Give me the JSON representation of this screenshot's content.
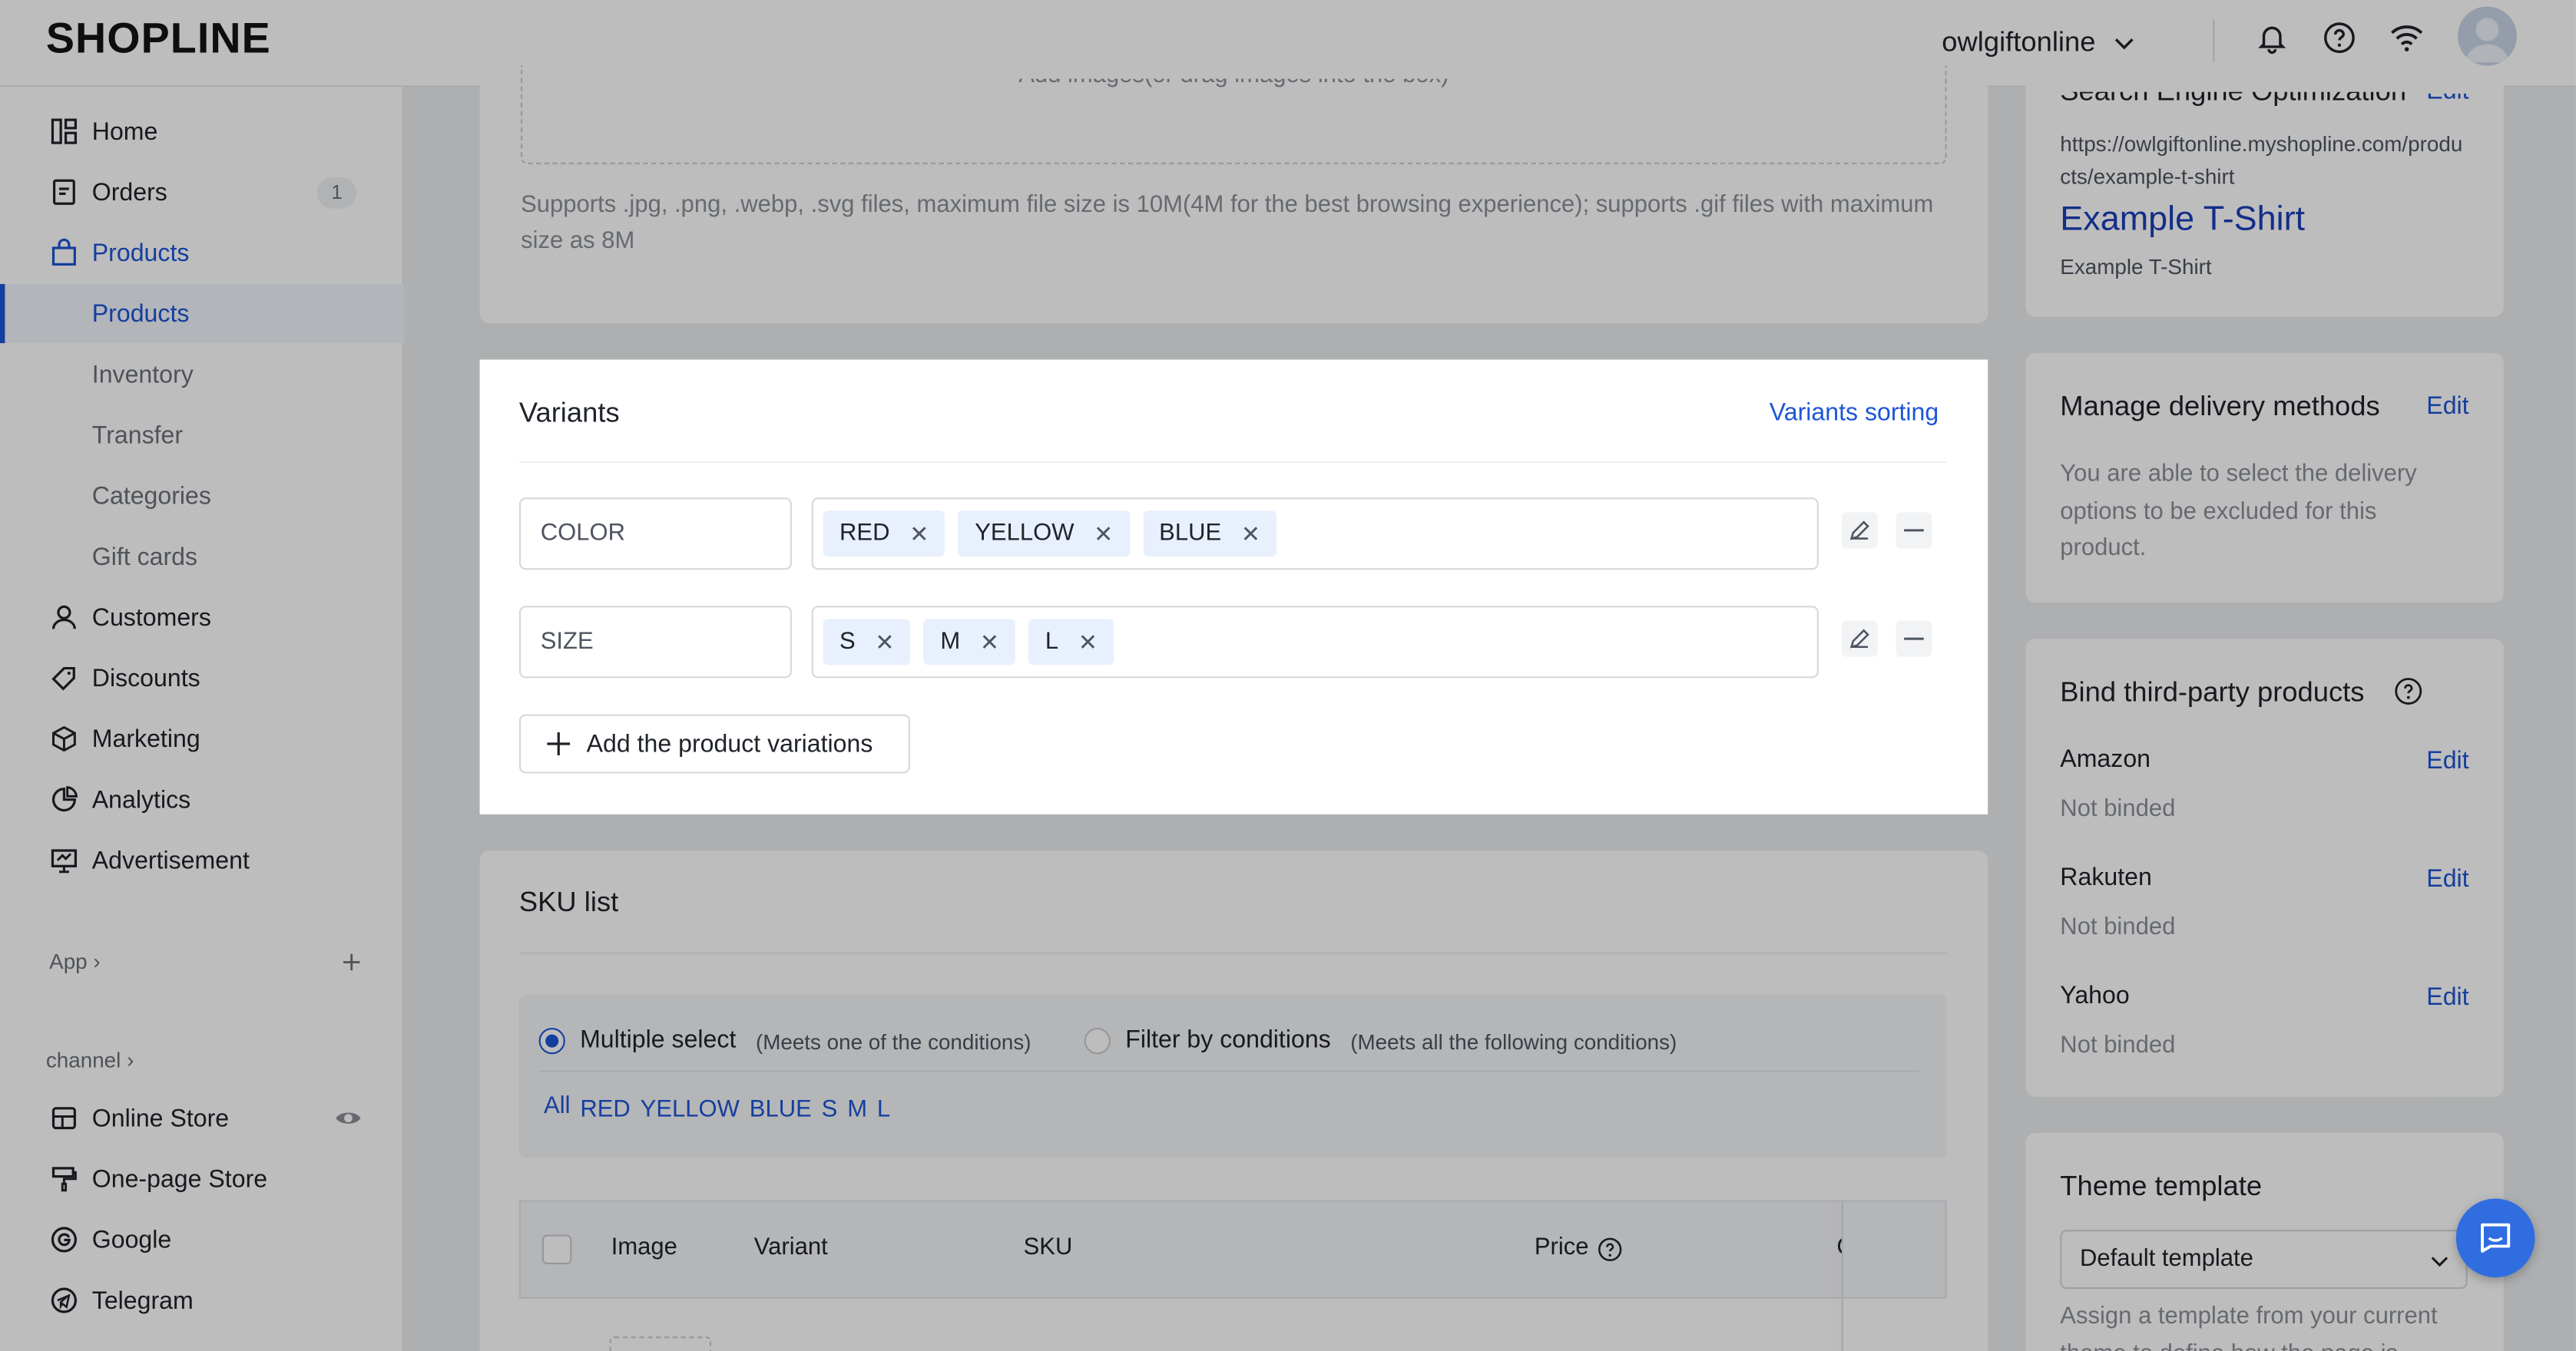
{
  "topbar": {
    "logo": "SHOPLINE",
    "store_name": "owlgiftonline",
    "icons": [
      "bell-icon",
      "help-icon",
      "wifi-icon",
      "avatar"
    ]
  },
  "sidebar": {
    "items": [
      {
        "label": "Home",
        "icon": "home-icon"
      },
      {
        "label": "Orders",
        "icon": "orders-icon",
        "badge": "1"
      },
      {
        "label": "Products",
        "icon": "bag-icon"
      },
      {
        "label": "Products"
      },
      {
        "label": "Inventory"
      },
      {
        "label": "Transfer"
      },
      {
        "label": "Categories"
      },
      {
        "label": "Gift cards"
      },
      {
        "label": "Customers",
        "icon": "person-icon"
      },
      {
        "label": "Discounts",
        "icon": "tag-icon"
      },
      {
        "label": "Marketing",
        "icon": "cube-icon"
      },
      {
        "label": "Analytics",
        "icon": "pie-icon"
      },
      {
        "label": "Advertisement",
        "icon": "monitor-icon"
      }
    ],
    "app_label": "App",
    "channel_label": "channel",
    "channels": [
      {
        "label": "Online Store",
        "icon": "store-icon"
      },
      {
        "label": "One-page Store",
        "icon": "brush-icon"
      },
      {
        "label": "Google",
        "icon": "google-icon"
      },
      {
        "label": "Telegram",
        "icon": "telegram-icon"
      }
    ]
  },
  "media": {
    "upload_text": "Add images(or drag images into the box)",
    "hint": "Supports .jpg, .png, .webp, .svg files, maximum file size is 10M(4M for the best browsing experience); supports .gif files with maximum size as 8M"
  },
  "variants": {
    "title": "Variants",
    "sorting_link": "Variants sorting",
    "options": [
      {
        "name": "COLOR",
        "values": [
          "RED",
          "YELLOW",
          "BLUE"
        ]
      },
      {
        "name": "SIZE",
        "values": [
          "S",
          "M",
          "L"
        ]
      }
    ],
    "add_button": "Add the product variations"
  },
  "sku": {
    "title": "SKU list",
    "multi_select": "Multiple select",
    "multi_select_hint": "(Meets one of the conditions)",
    "filter_conditions": "Filter by conditions",
    "filter_conditions_hint": "(Meets all the following conditions)",
    "chips": [
      "All",
      "RED",
      "YELLOW",
      "BLUE",
      "S",
      "M",
      "L"
    ],
    "columns": [
      "Image",
      "Variant",
      "SKU",
      "Price",
      "C"
    ]
  },
  "seo": {
    "title": "Search Engine Optimization",
    "edit": "Edit",
    "url": "https://owlgiftonline.myshopline.com/products/example-t-shirt",
    "page_title": "Example T-Shirt",
    "description": "Example T-Shirt"
  },
  "delivery": {
    "title": "Manage delivery methods",
    "edit": "Edit",
    "text": "You are able to select the delivery options to be excluded for this product."
  },
  "third_party": {
    "title": "Bind third-party products",
    "platforms": [
      {
        "name": "Amazon",
        "edit": "Edit",
        "status": "Not binded"
      },
      {
        "name": "Rakuten",
        "edit": "Edit",
        "status": "Not binded"
      },
      {
        "name": "Yahoo",
        "edit": "Edit",
        "status": "Not binded"
      }
    ]
  },
  "theme": {
    "title": "Theme template",
    "selected": "Default template",
    "text": "Assign a template from your current theme to define how the page is"
  },
  "colors": {
    "accent": "#1d55d6",
    "tag_bg": "#e8f0fd",
    "chat": "#2f6de1"
  }
}
